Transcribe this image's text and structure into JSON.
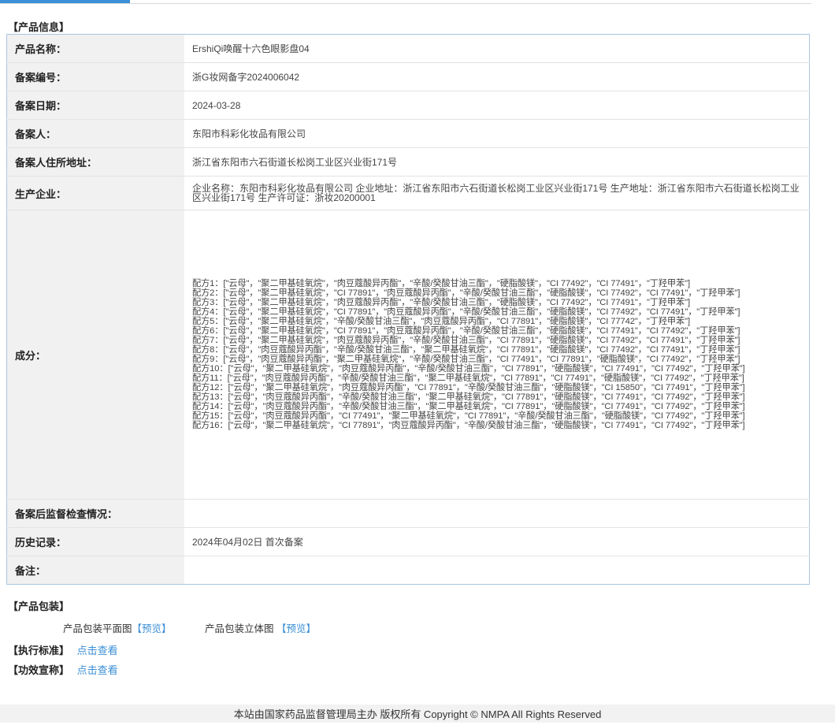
{
  "sections": {
    "product_info": "【产品信息】",
    "packaging": "【产品包装】",
    "standard": "【执行标准】",
    "efficacy": "【功效宣称】"
  },
  "rows": {
    "name": {
      "label": "产品名称：",
      "value": "ErshiQi唤醒十六色眼影盘04"
    },
    "record_no": {
      "label": "备案编号：",
      "value": "浙G妆网备字2024006042"
    },
    "record_date": {
      "label": "备案日期：",
      "value": "2024-03-28"
    },
    "registrant": {
      "label": "备案人：",
      "value": "东阳市科彩化妆品有限公司"
    },
    "address": {
      "label": "备案人住所地址：",
      "value": "浙江省东阳市六石街道长松岗工业区兴业街171号"
    },
    "manufacturer": {
      "label": "生产企业：",
      "value": "企业名称：东阳市科彩化妆品有限公司 企业地址：浙江省东阳市六石街道长松岗工业区兴业街171号 生产地址：浙江省东阳市六石街道长松岗工业区兴业街171号 生产许可证：浙妆20200001"
    },
    "ingredients": {
      "label": "成分："
    },
    "inspection": {
      "label": "备案后监督检查情况：",
      "value": ""
    },
    "history": {
      "label": "历史记录：",
      "value": "2024年04月02日 首次备案"
    },
    "remarks": {
      "label": "备注：",
      "value": ""
    }
  },
  "formulas": [
    "配方1：[\"云母\"，\"聚二甲基硅氧烷\"，\"肉豆蔻酸异丙酯\"，\"辛酸/癸酸甘油三酯\"，\"硬脂酸镁\"，\"CI 77492\"，\"CI 77491\"，\"丁羟甲苯\"]",
    "配方2：[\"云母\"，\"聚二甲基硅氧烷\"，\"CI 77891\"，\"肉豆蔻酸异丙酯\"，\"辛酸/癸酸甘油三酯\"，\"硬脂酸镁\"，\"CI 77492\"，\"CI 77491\"，\"丁羟甲苯\"]",
    "配方3：[\"云母\"，\"聚二甲基硅氧烷\"，\"肉豆蔻酸异丙酯\"，\"辛酸/癸酸甘油三酯\"，\"硬脂酸镁\"，\"CI 77492\"，\"CI 77491\"，\"丁羟甲苯\"]",
    "配方4：[\"云母\"，\"聚二甲基硅氧烷\"，\"CI 77891\"，\"肉豆蔻酸异丙酯\"，\"辛酸/癸酸甘油三酯\"，\"硬脂酸镁\"，\"CI 77492\"，\"CI 77491\"，\"丁羟甲苯\"]",
    "配方5：[\"云母\"，\"聚二甲基硅氧烷\"，\"辛酸/癸酸甘油三酯\"，\"肉豆蔻酸异丙酯\"，\"CI 77891\"，\"硬脂酸镁\"，\"CI 77742\"，\"丁羟甲苯\"]",
    "配方6：[\"云母\"，\"聚二甲基硅氧烷\"，\"CI 77891\"，\"肉豆蔻酸异丙酯\"，\"辛酸/癸酸甘油三酯\"，\"硬脂酸镁\"，\"CI 77491\"，\"CI 77492\"，\"丁羟甲苯\"]",
    "配方7：[\"云母\"，\"聚二甲基硅氧烷\"，\"肉豆蔻酸异丙酯\"，\"辛酸/癸酸甘油三酯\"，\"CI 77891\"，\"硬脂酸镁\"，\"CI 77492\"，\"CI 77491\"，\"丁羟甲苯\"]",
    "配方8：[\"云母\"，\"肉豆蔻酸异丙酯\"，\"辛酸/癸酸甘油三酯\"，\"聚二甲基硅氧烷\"，\"CI 77891\"，\"硬脂酸镁\"，\"CI 77492\"，\"CI 77491\"，\"丁羟甲苯\"]",
    "配方9：[\"云母\"，\"肉豆蔻酸异丙酯\"，\"聚二甲基硅氧烷\"，\"辛酸/癸酸甘油三酯\"，\"CI 77491\"，\"CI 77891\"，\"硬脂酸镁\"，\"CI 77492\"，\"丁羟甲苯\"]",
    "配方10：[\"云母\"，\"聚二甲基硅氧烷\"，\"肉豆蔻酸异丙酯\"，\"辛酸/癸酸甘油三酯\"，\"CI 77891\"，\"硬脂酸镁\"，\"CI 77491\"，\"CI 77492\"，\"丁羟甲苯\"]",
    "配方11：[\"云母\"，\"肉豆蔻酸异丙酯\"，\"辛酸/癸酸甘油三酯\"，\"聚二甲基硅氧烷\"，\"CI 77891\"，\"CI 77491\"，\"硬脂酸镁\"，\"CI 77492\"，\"丁羟甲苯\"]",
    "配方12：[\"云母\"，\"聚二甲基硅氧烷\"，\"肉豆蔻酸异丙酯\"，\"CI 77891\"，\"辛酸/癸酸甘油三酯\"，\"硬脂酸镁\"，\"CI 15850\"，\"CI 77491\"，\"丁羟甲苯\"]",
    "配方13：[\"云母\"，\"肉豆蔻酸异丙酯\"，\"辛酸/癸酸甘油三酯\"，\"聚二甲基硅氧烷\"，\"CI 77891\"，\"硬脂酸镁\"，\"CI 77491\"，\"CI 77492\"，\"丁羟甲苯\"]",
    "配方14：[\"云母\"，\"肉豆蔻酸异丙酯\"，\"辛酸/癸酸甘油三酯\"，\"聚二甲基硅氧烷\"，\"CI 77891\"，\"硬脂酸镁\"，\"CI 77491\"，\"CI 77492\"，\"丁羟甲苯\"]",
    "配方15：[\"云母\"，\"肉豆蔻酸异丙酯\"，\"CI 77491\"，\"聚二甲基硅氧烷\"，\"CI 77891\"，\"辛酸/癸酸甘油三酯\"，\"硬脂酸镁\"，\"CI 77492\"，\"丁羟甲苯\"]",
    "配方16：[\"云母\"，\"聚二甲基硅氧烷\"，\"CI 77891\"，\"肉豆蔻酸异丙酯\"，\"辛酸/癸酸甘油三酯\"，\"硬脂酸镁\"，\"CI 77491\"，\"CI 77492\"，\"丁羟甲苯\"]"
  ],
  "packaging": {
    "flat_label": "产品包装平面图",
    "flat_link": "【预览】",
    "solid_label": "产品包装立体图",
    "solid_link": "【预览】"
  },
  "links": {
    "standard": "点击查看",
    "efficacy": "点击查看"
  },
  "footer": "本站由国家药品监督管理局主办 版权所有 Copyright © NMPA All Rights Reserved",
  "colors": {
    "link": "#3b8fd6",
    "label_bg": "#f1f1f1",
    "table_border": "#a9c6e3"
  }
}
